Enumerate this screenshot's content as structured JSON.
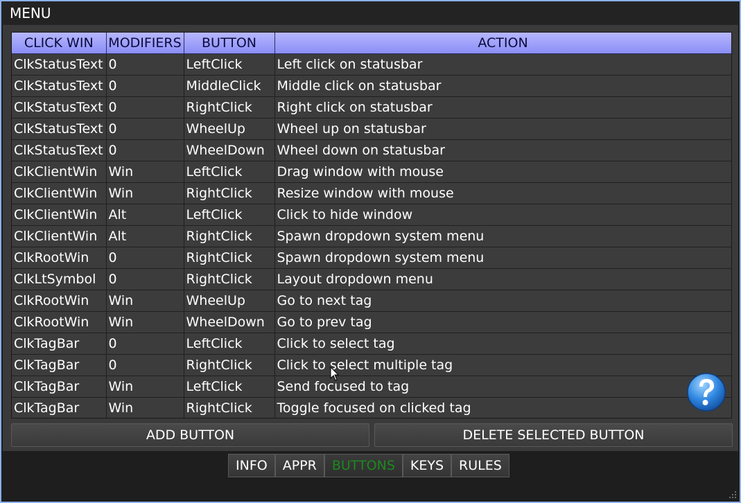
{
  "window": {
    "title": "MENU"
  },
  "table": {
    "headers": [
      "CLICK WIN",
      "MODIFIERS",
      "BUTTON",
      "ACTION"
    ],
    "rows": [
      [
        "ClkStatusText",
        "0",
        "LeftClick",
        "Left click on statusbar"
      ],
      [
        "ClkStatusText",
        "0",
        "MiddleClick",
        "Middle click on statusbar"
      ],
      [
        "ClkStatusText",
        "0",
        "RightClick",
        "Right click on statusbar"
      ],
      [
        "ClkStatusText",
        "0",
        "WheelUp",
        "Wheel up on statusbar"
      ],
      [
        "ClkStatusText",
        "0",
        "WheelDown",
        "Wheel down on statusbar"
      ],
      [
        "ClkClientWin",
        "Win",
        "LeftClick",
        "Drag window with mouse"
      ],
      [
        "ClkClientWin",
        "Win",
        "RightClick",
        "Resize window with mouse"
      ],
      [
        "ClkClientWin",
        "Alt",
        "LeftClick",
        "Click to hide window"
      ],
      [
        "ClkClientWin",
        "Alt",
        "RightClick",
        "Spawn dropdown system menu"
      ],
      [
        "ClkRootWin",
        "0",
        "RightClick",
        "Spawn dropdown system menu"
      ],
      [
        "ClkLtSymbol",
        "0",
        "RightClick",
        "Layout dropdown menu"
      ],
      [
        "ClkRootWin",
        "Win",
        "WheelUp",
        "Go to next tag"
      ],
      [
        "ClkRootWin",
        "Win",
        "WheelDown",
        "Go to prev tag"
      ],
      [
        "ClkTagBar",
        "0",
        "LeftClick",
        "Click to select tag"
      ],
      [
        "ClkTagBar",
        "0",
        "RightClick",
        "Click to select multiple tag"
      ],
      [
        "ClkTagBar",
        "Win",
        "LeftClick",
        "Send focused to tag"
      ],
      [
        "ClkTagBar",
        "Win",
        "RightClick",
        "Toggle focused on clicked tag"
      ]
    ]
  },
  "actions": {
    "add_label": "ADD BUTTON",
    "delete_label": "DELETE SELECTED BUTTON"
  },
  "tabs": [
    {
      "label": "INFO",
      "active": false
    },
    {
      "label": "APPR",
      "active": false
    },
    {
      "label": "BUTTONS",
      "active": true
    },
    {
      "label": "KEYS",
      "active": false
    },
    {
      "label": "RULES",
      "active": false
    }
  ],
  "icons": {
    "help": "help-icon",
    "cursor": "mouse-pointer-icon",
    "resize": "resize-grip-icon"
  },
  "colors": {
    "header_bg": "#9da0f8",
    "active_tab_text": "#1c8a1c",
    "border": "#8ab0e8"
  }
}
